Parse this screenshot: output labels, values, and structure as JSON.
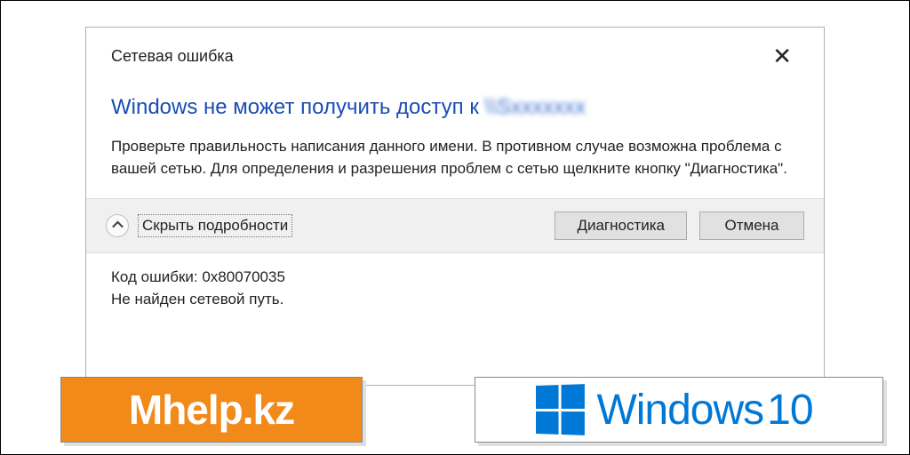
{
  "dialog": {
    "title": "Сетевая ошибка",
    "headline_prefix": "Windows не может получить доступ к ",
    "headline_path": "\\\\Sxxxxxxx",
    "body": "Проверьте правильность написания данного имени. В противном случае возможна проблема с вашей сетью. Для определения и разрешения проблем с сетью щелкните кнопку \"Диагностика\".",
    "details_toggle": "Скрыть подробности",
    "buttons": {
      "diagnose": "Диагностика",
      "cancel": "Отмена"
    },
    "details": {
      "line1": "Код ошибки: 0x80070035",
      "line2": "Не найден сетевой путь."
    }
  },
  "badges": {
    "mhelp": "Mhelp.kz",
    "win10_word": "Windows",
    "win10_ver": "10"
  }
}
